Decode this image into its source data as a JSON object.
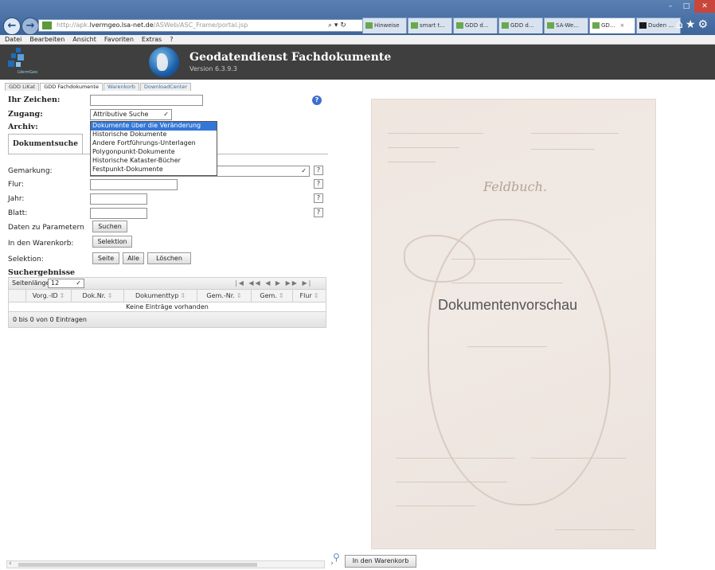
{
  "browser": {
    "url_prefix": "http://apk.",
    "url_host": "lvermgeo.lsa-net.de",
    "url_path": "/ASWeb/ASC_Frame/portal.jsp",
    "search_glyph": "⌕ ▾ ↻",
    "tabs": [
      {
        "label": "Hinweise"
      },
      {
        "label": "smart t..."
      },
      {
        "label": "GDD d..."
      },
      {
        "label": "GDD d..."
      },
      {
        "label": "SA-We..."
      },
      {
        "label": "GD...",
        "close": "×"
      },
      {
        "label": "Duden ..."
      }
    ],
    "menu": [
      "Datei",
      "Bearbeiten",
      "Ansicht",
      "Favoriten",
      "Extras",
      "?"
    ]
  },
  "header": {
    "logo_text": "LVermGeo",
    "title": "Geodatendienst Fachdokumente",
    "version": "Version 6.3.9.3"
  },
  "apptabs": [
    "GDD LiKat",
    "GDD Fachdokumente",
    "Warenkorb",
    "DownloadCenter"
  ],
  "form": {
    "ihr_zeichen_label": "Ihr Zeichen:",
    "zugang_label": "Zugang:",
    "zugang_value": "Attributive Suche",
    "archiv_label": "Archiv:",
    "archiv_options": [
      "Dokumente über die Veränderung",
      "Historische Dokumente",
      "Andere Fortführungs-Unterlagen",
      "Polygonpunkt-Dokumente",
      "Historische Kataster-Bücher",
      "Festpunkt-Dokumente"
    ],
    "subtab": "Dokumentsuche",
    "gemarkung_label": "Gemarkung:",
    "flur_label": "Flur:",
    "jahr_label": "Jahr:",
    "blatt_label": "Blatt:",
    "help": "?",
    "daten_label": "Daten zu Parametern",
    "suchen_button": "Suchen",
    "warenkorb_label": "In den Warenkorb:",
    "selektion_button": "Selektion",
    "selektion_label": "Selektion:",
    "seite_button": "Seite",
    "alle_button": "Alle",
    "loeschen_button": "Löschen"
  },
  "results": {
    "title": "Suchergebnisse",
    "page_length_label": "Seitenlänge:",
    "page_length_value": "12",
    "pager": "|◀ ◀◀ ◀ ▶ ▶▶ ▶|",
    "columns": [
      "Vorg.-ID",
      "Dok.Nr.",
      "Dokumenttyp",
      "Gem.-Nr.",
      "Gem.",
      "Flur"
    ],
    "empty_text": "Keine Einträge vorhanden",
    "footer": "0 bis 0 von 0 Eintragen"
  },
  "preview": {
    "label": "Dokumentenvorschau",
    "doc_title": "Feldbuch.",
    "cart_button": "In den Warenkorb"
  },
  "colors": {
    "header_bg": "#3f3f3f",
    "selection_blue": "#3377d6",
    "chrome_blue": "#3d659c"
  }
}
